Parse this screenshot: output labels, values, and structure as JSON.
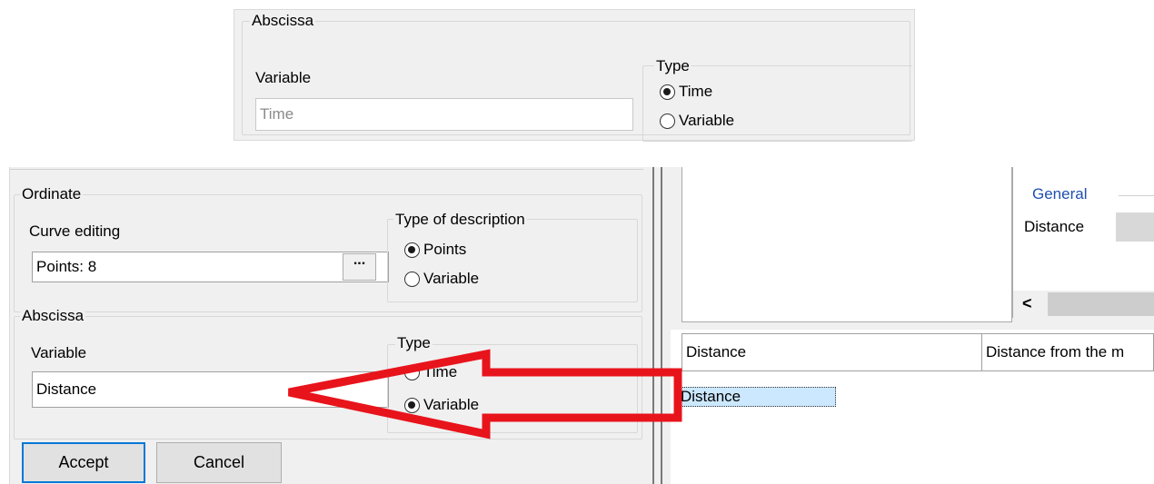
{
  "top_panel": {
    "abscissa_title": "Abscissa",
    "variable_label": "Variable",
    "variable_placeholder": "Time",
    "type_title": "Type",
    "type_options": [
      "Time",
      "Variable"
    ]
  },
  "dialog": {
    "ordinate_title": "Ordinate",
    "curve_editing_label": "Curve editing",
    "curve_editing_value": "Points: 8",
    "browse_button": "...",
    "type_of_description_title": "Type of description",
    "description_options": [
      "Points",
      "Variable"
    ],
    "abscissa_title": "Abscissa",
    "variable_label": "Variable",
    "variable_value": "Distance",
    "type_title": "Type",
    "type_options": [
      "Time",
      "Variable"
    ],
    "accept_button": "Accept",
    "cancel_button": "Cancel"
  },
  "right_panel": {
    "section_title": "General",
    "list_item": "Distance",
    "scroll_left": "<",
    "name_field": "Distance",
    "description_field": "Distance from the m",
    "selected_item": "Distance"
  },
  "colors": {
    "arrow": "#e8141c",
    "accent": "#0078d7",
    "selection": "#cce8ff"
  }
}
